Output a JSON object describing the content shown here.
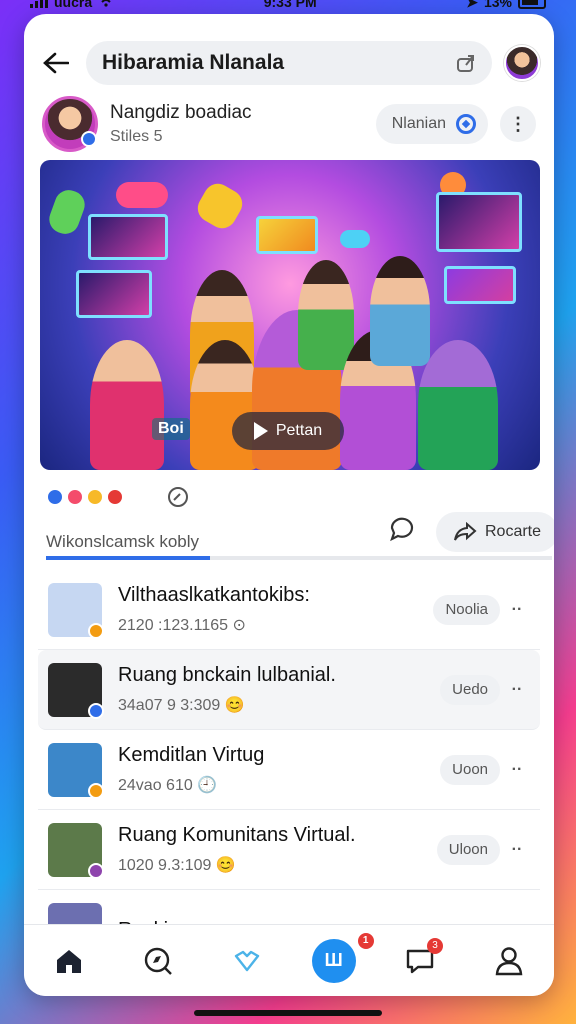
{
  "status": {
    "carrier": "uucra",
    "time": "9:33 PM",
    "battery": "13%"
  },
  "header": {
    "title": "Hibaramia  Nlanala"
  },
  "profile": {
    "name": "Nangdiz boadiac",
    "subtitle": "Stiles 5",
    "follow_label": "Nlanian"
  },
  "video": {
    "play_label": "Pettan",
    "tag": "Boi"
  },
  "reactions": {
    "text": "Wikonslcamsk kobly",
    "share_label": "Rocarte"
  },
  "list": [
    {
      "title": "Vilthaaslkatkantokibs:",
      "meta": "2120 :123.1165",
      "action": "Noolia",
      "thumb": "#c6d7f2",
      "badge": "#f39c12"
    },
    {
      "title": "Ruang bnckain lulbanial.",
      "meta": "34a07 9 3:309",
      "action": "Uedo",
      "thumb": "#2b2b2b",
      "badge": "#2f6de8"
    },
    {
      "title": "Kemditlan Virtug",
      "meta": "24vao 610",
      "action": "Uoon",
      "thumb": "#3c87c9",
      "badge": "#f39c12"
    },
    {
      "title": "Ruang Komunitans Virtual.",
      "meta": "1020 9.3:109",
      "action": "Uloon",
      "thumb": "#5c7a4a",
      "badge": "#8e44ad"
    },
    {
      "title": "Rocki",
      "meta": "",
      "action": "",
      "thumb": "#6c6fb0",
      "badge": ""
    }
  ],
  "nav": {
    "center_label": "Ш",
    "notif_badge": "1",
    "inbox_badge": "3"
  }
}
